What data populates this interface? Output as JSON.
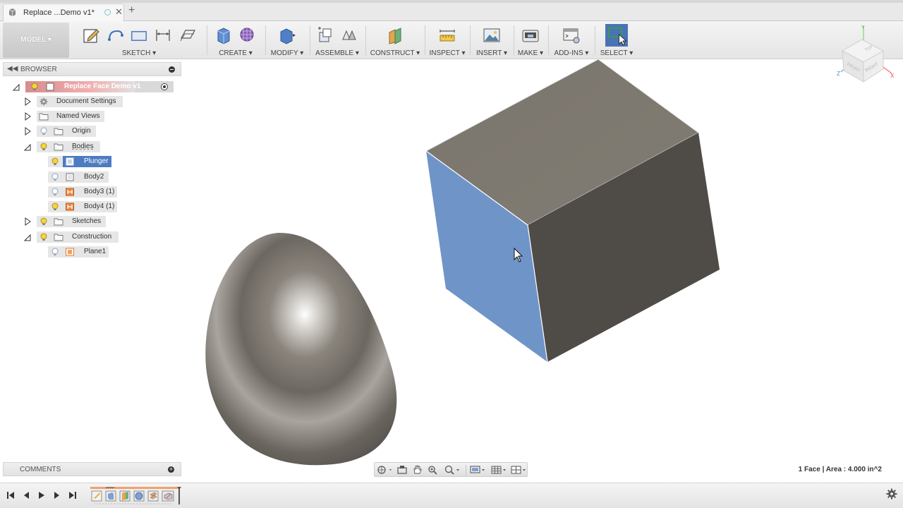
{
  "tab": {
    "title": "Replace ...Demo v1*"
  },
  "toolbar": {
    "workspace": "MODEL ▾",
    "groups": {
      "sketch": "SKETCH ▾",
      "create": "CREATE ▾",
      "modify": "MODIFY ▾",
      "assemble": "ASSEMBLE ▾",
      "construct": "CONSTRUCT ▾",
      "inspect": "INSPECT ▾",
      "insert": "INSERT ▾",
      "make": "MAKE ▾",
      "addins": "ADD-INS ▾",
      "select": "SELECT ▾"
    }
  },
  "browser": {
    "title": "BROWSER",
    "root": "Replace Face Demo v1",
    "items": {
      "document_settings": "Document Settings",
      "named_views": "Named Views",
      "origin": "Origin",
      "bodies": "Bodies",
      "plunger": "Plunger",
      "body2": "Body2",
      "body3": "Body3 (1)",
      "body4": "Body4 (1)",
      "sketches": "Sketches",
      "construction": "Construction",
      "plane1": "Plane1"
    }
  },
  "comments": {
    "title": "COMMENTS"
  },
  "status": {
    "selection": "1 Face | Area : 4.000 in^2"
  },
  "viewcube": {
    "right_label": "RIGHT",
    "front_label": "FRONT",
    "top_label": "TOP",
    "axis_x": "X",
    "axis_y": "Y",
    "axis_z": "Z"
  },
  "colors": {
    "selected_face": "#6f94c8",
    "body_top": "#7c776e",
    "body_side": "#4f4b46",
    "accent_blue": "#4a73b6",
    "highlight_row": "#4d7cc2"
  }
}
